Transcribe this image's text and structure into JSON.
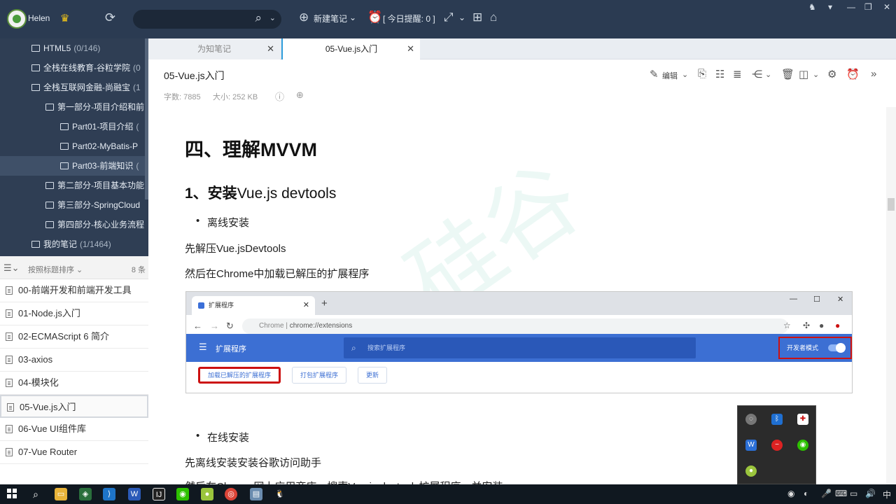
{
  "topbar": {
    "username": "Helen",
    "new_note_label": "新建笔记",
    "reminder_label": "[ 今日提醒: 0 ]"
  },
  "tree": {
    "items": [
      {
        "label": "HTML5",
        "count": "(0/146)"
      },
      {
        "label": "全栈在线教育-谷粒学院",
        "count": "(0"
      },
      {
        "label": "全栈互联网金融-尚融宝",
        "count": "(1"
      },
      {
        "label": "第一部分-项目介绍和前",
        "count": ""
      },
      {
        "label": "Part01-项目介绍",
        "count": "("
      },
      {
        "label": "Part02-MyBatis-P",
        "count": ""
      },
      {
        "label": "Part03-前端知识",
        "count": "("
      },
      {
        "label": "第二部分-项目基本功能",
        "count": ""
      },
      {
        "label": "第三部分-SpringCloud",
        "count": ""
      },
      {
        "label": "第四部分-核心业务流程",
        "count": ""
      },
      {
        "label": "我的笔记",
        "count": "(1/1464)"
      }
    ]
  },
  "sortbar": {
    "label": "按照标题排序",
    "count": "8 条"
  },
  "notes": [
    "00-前端开发和前端开发工具",
    "01-Node.js入门",
    "02-ECMAScript 6 简介",
    "03-axios",
    "04-模块化",
    "05-Vue.js入门",
    "06-Vue UI组件库",
    "07-Vue Router"
  ],
  "tabs": [
    {
      "title": "为知笔记"
    },
    {
      "title": "05-Vue.js入门"
    }
  ],
  "note_header": {
    "title": "05-Vue.js入门",
    "word_count": "字数: 7885",
    "size": "大小: 252 KB",
    "edit_label": "编辑"
  },
  "content": {
    "watermark": "硅谷",
    "h1": "四、理解MVVM",
    "h2_prefix": "1、安装",
    "h2_rest": "Vue.js devtools",
    "bullet1": "离线安装",
    "para1": "先解压Vue.jsDevtools",
    "para2": "然后在Chrome中加载已解压的扩展程序",
    "bullet2": "在线安装",
    "para3": "先离线安装安装谷歌访问助手",
    "para4": "然后在Chrome网上应用商店，搜索Vue.js devtools扩展程序，并安装"
  },
  "chrome_shot": {
    "tab_title": "扩展程序",
    "url_chrome": "Chrome",
    "url_sep": "|",
    "url_path": "chrome://extensions",
    "bar_title": "扩展程序",
    "search_placeholder": "搜索扩展程序",
    "dev_mode": "开发者模式",
    "btn_load": "加载已解压的扩展程序",
    "btn_pack": "打包扩展程序",
    "btn_update": "更新"
  },
  "taskbar": {
    "ime": "中"
  },
  "colors": {
    "topbar": "#2b3b52",
    "tree_bg": "#2f3e54",
    "accent": "#2d9cdb",
    "chrome_blue": "#3c6fd3",
    "highlight_red": "#cc1111"
  }
}
